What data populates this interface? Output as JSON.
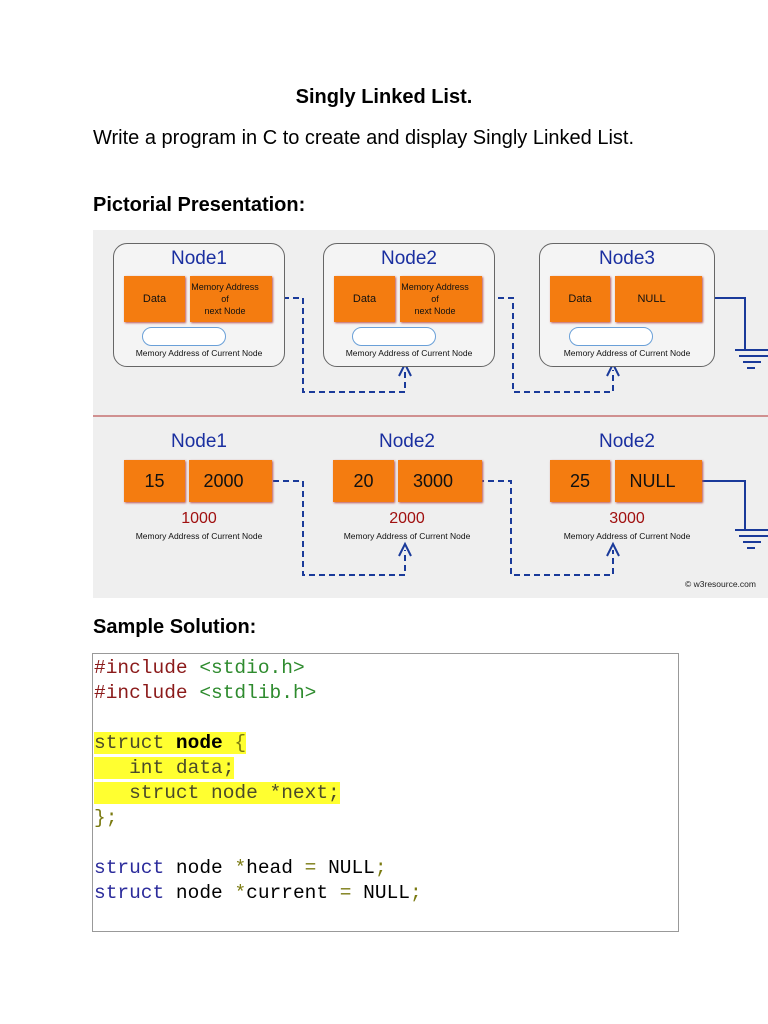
{
  "title": "Singly Linked List.",
  "intro": "Write a program in C to create and display Singly Linked List.",
  "pictorial_heading": "Pictorial Presentation:",
  "solution_heading": "Sample Solution:",
  "diagram": {
    "top": {
      "nodes": [
        {
          "title": "Node1",
          "data": "Data",
          "next": [
            "Memory Address",
            "of",
            "next Node"
          ],
          "caption": "Memory Address of Current Node"
        },
        {
          "title": "Node2",
          "data": "Data",
          "next": [
            "Memory Address",
            "of",
            "next Node"
          ],
          "caption": "Memory Address of Current Node"
        },
        {
          "title": "Node3",
          "data": "Data",
          "next": [
            "NULL"
          ],
          "caption": "Memory Address of Current Node"
        }
      ]
    },
    "bottom": {
      "nodes": [
        {
          "title": "Node1",
          "data": "15",
          "next": "2000",
          "address": "1000",
          "caption": "Memory Address of Current Node"
        },
        {
          "title": "Node2",
          "data": "20",
          "next": "3000",
          "address": "2000",
          "caption": "Memory Address of Current Node"
        },
        {
          "title": "Node2",
          "data": "25",
          "next": "NULL",
          "address": "3000",
          "caption": "Memory Address of Current Node"
        }
      ]
    },
    "credit": "© w3resource.com"
  },
  "code": {
    "l1a": "#include",
    "l1b": " <stdio.h>",
    "l2a": "#include",
    "l2b": " <stdlib.h>",
    "l4a": "struct ",
    "l4b": "node",
    "l4c": " {",
    "l5": "   int data;",
    "l6": "   struct node *next;",
    "l7": "};",
    "s": "struct",
    "n": " node ",
    "star": "*",
    "head": "head",
    "eq": " = ",
    "null": "NULL",
    "semi": ";",
    "cur": "current"
  }
}
